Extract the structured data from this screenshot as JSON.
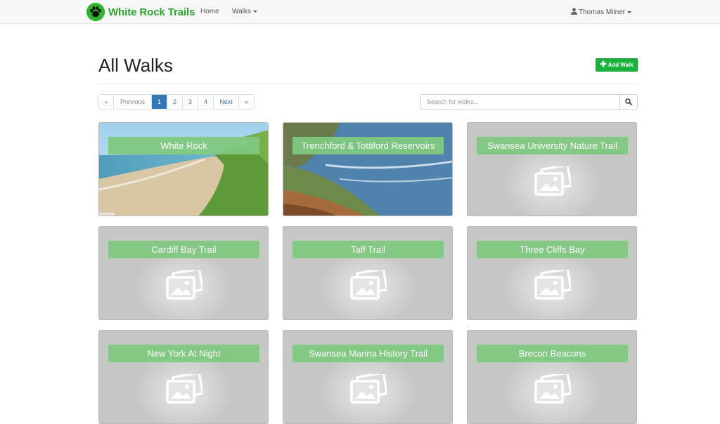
{
  "navbar": {
    "brand": "White Rock Trails",
    "links": [
      {
        "label": "Home"
      },
      {
        "label": "Walks"
      }
    ],
    "user": "Thomas Milner"
  },
  "header": {
    "title": "All Walks",
    "add_button": "Add Walk"
  },
  "pagination": {
    "first": "«",
    "previous": "Previous",
    "pages": [
      "1",
      "2",
      "3",
      "4"
    ],
    "next": "Next",
    "last": "»",
    "active_page": "1"
  },
  "search": {
    "placeholder": "Search for walks..."
  },
  "walks": [
    {
      "name": "White Rock",
      "image": "beach-photo"
    },
    {
      "name": "Trenchford & Tottiford Reservoirs",
      "image": "coast-photo"
    },
    {
      "name": "Swansea University Nature Trail",
      "image": "placeholder"
    },
    {
      "name": "Cardiff Bay Trail",
      "image": "placeholder"
    },
    {
      "name": "Taff Trail",
      "image": "placeholder"
    },
    {
      "name": "Three Cliffs Bay",
      "image": "placeholder"
    },
    {
      "name": "New York At Night",
      "image": "placeholder"
    },
    {
      "name": "Swansea Marina History Trail",
      "image": "placeholder"
    },
    {
      "name": "Brecon Beacons",
      "image": "placeholder"
    }
  ],
  "colors": {
    "brand_green": "#2aa52a",
    "add_button_green": "#19b33b",
    "label_green": "#80c880",
    "link_blue": "#337ab7",
    "card_gray": "#c6c6c6"
  },
  "icons": [
    "paw-icon",
    "caret-down-icon",
    "user-icon",
    "plus-icon",
    "search-icon",
    "image-placeholder-icon"
  ]
}
